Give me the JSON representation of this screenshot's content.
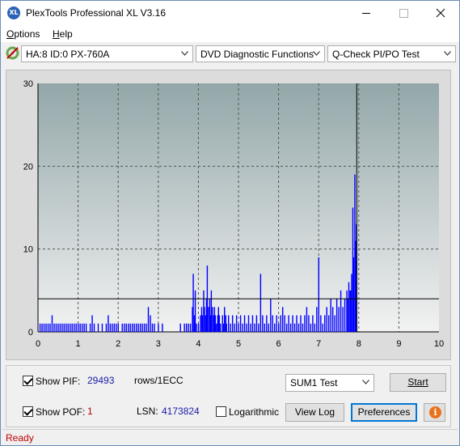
{
  "window": {
    "title": "PlexTools Professional XL V3.16",
    "icon_text": "XL"
  },
  "menu": [
    {
      "label": "Options",
      "accel": "O",
      "rest": "ptions"
    },
    {
      "label": "Help",
      "accel": "H",
      "rest": "elp"
    }
  ],
  "toolbar": {
    "drive": "HA:8 ID:0  PX-760A",
    "function": "DVD Diagnostic Functions",
    "test": "Q-Check PI/PO Test"
  },
  "chart_data": {
    "type": "bar",
    "xlim": [
      0,
      10
    ],
    "ylim": [
      0,
      30
    ],
    "x_ticks": [
      "0",
      "1",
      "2",
      "3",
      "4",
      "5",
      "6",
      "7",
      "8",
      "9",
      "10"
    ],
    "y_ticks": [
      "0",
      "10",
      "20",
      "30"
    ],
    "threshold_line": 4,
    "end_marker_x": 7.95,
    "grid": true,
    "series": [
      {
        "color": "#0000ff",
        "points": [
          [
            0.05,
            1
          ],
          [
            0.1,
            1
          ],
          [
            0.15,
            1
          ],
          [
            0.2,
            1
          ],
          [
            0.25,
            1
          ],
          [
            0.3,
            1
          ],
          [
            0.35,
            2
          ],
          [
            0.4,
            1
          ],
          [
            0.45,
            1
          ],
          [
            0.5,
            1
          ],
          [
            0.55,
            1
          ],
          [
            0.6,
            1
          ],
          [
            0.65,
            1
          ],
          [
            0.7,
            1
          ],
          [
            0.75,
            1
          ],
          [
            0.8,
            1
          ],
          [
            0.85,
            1
          ],
          [
            0.9,
            1
          ],
          [
            0.95,
            1
          ],
          [
            1.0,
            1
          ],
          [
            1.05,
            1
          ],
          [
            1.1,
            1
          ],
          [
            1.15,
            1
          ],
          [
            1.2,
            1
          ],
          [
            1.3,
            1
          ],
          [
            1.35,
            2
          ],
          [
            1.4,
            1
          ],
          [
            1.5,
            1
          ],
          [
            1.6,
            1
          ],
          [
            1.7,
            1
          ],
          [
            1.75,
            2
          ],
          [
            1.8,
            1
          ],
          [
            1.85,
            1
          ],
          [
            1.9,
            1
          ],
          [
            1.95,
            1
          ],
          [
            2.0,
            1
          ],
          [
            2.1,
            1
          ],
          [
            2.15,
            1
          ],
          [
            2.2,
            1
          ],
          [
            2.25,
            1
          ],
          [
            2.3,
            1
          ],
          [
            2.35,
            1
          ],
          [
            2.4,
            1
          ],
          [
            2.45,
            1
          ],
          [
            2.5,
            1
          ],
          [
            2.55,
            1
          ],
          [
            2.6,
            1
          ],
          [
            2.65,
            1
          ],
          [
            2.7,
            1
          ],
          [
            2.75,
            3
          ],
          [
            2.8,
            2
          ],
          [
            2.85,
            1
          ],
          [
            2.9,
            1
          ],
          [
            3.0,
            1
          ],
          [
            3.1,
            1
          ],
          [
            3.55,
            1
          ],
          [
            3.65,
            1
          ],
          [
            3.7,
            1
          ],
          [
            3.75,
            1
          ],
          [
            3.8,
            1
          ],
          [
            3.85,
            3
          ],
          [
            3.87,
            7
          ],
          [
            3.9,
            2
          ],
          [
            3.92,
            5
          ],
          [
            3.95,
            1
          ],
          [
            4.0,
            1
          ],
          [
            4.05,
            2
          ],
          [
            4.08,
            3
          ],
          [
            4.1,
            2
          ],
          [
            4.13,
            5
          ],
          [
            4.15,
            3
          ],
          [
            4.18,
            2
          ],
          [
            4.2,
            4
          ],
          [
            4.22,
            8
          ],
          [
            4.25,
            3
          ],
          [
            4.28,
            4
          ],
          [
            4.3,
            2
          ],
          [
            4.32,
            5
          ],
          [
            4.35,
            3
          ],
          [
            4.38,
            2
          ],
          [
            4.4,
            3
          ],
          [
            4.42,
            2
          ],
          [
            4.45,
            1
          ],
          [
            4.48,
            2
          ],
          [
            4.5,
            3
          ],
          [
            4.52,
            2
          ],
          [
            4.55,
            1
          ],
          [
            4.6,
            2
          ],
          [
            4.62,
            1
          ],
          [
            4.65,
            3
          ],
          [
            4.68,
            2
          ],
          [
            4.7,
            1
          ],
          [
            4.75,
            2
          ],
          [
            4.8,
            1
          ],
          [
            4.85,
            2
          ],
          [
            4.9,
            1
          ],
          [
            4.95,
            2
          ],
          [
            5.0,
            1
          ],
          [
            5.05,
            2
          ],
          [
            5.1,
            1
          ],
          [
            5.15,
            2
          ],
          [
            5.2,
            1
          ],
          [
            5.25,
            2
          ],
          [
            5.3,
            1
          ],
          [
            5.35,
            2
          ],
          [
            5.4,
            1
          ],
          [
            5.45,
            2
          ],
          [
            5.5,
            1
          ],
          [
            5.55,
            7
          ],
          [
            5.6,
            2
          ],
          [
            5.65,
            1
          ],
          [
            5.7,
            2
          ],
          [
            5.75,
            1
          ],
          [
            5.8,
            4
          ],
          [
            5.85,
            2
          ],
          [
            5.9,
            1
          ],
          [
            5.95,
            2
          ],
          [
            6.0,
            1
          ],
          [
            6.05,
            2
          ],
          [
            6.1,
            3
          ],
          [
            6.15,
            2
          ],
          [
            6.2,
            1
          ],
          [
            6.25,
            2
          ],
          [
            6.3,
            1
          ],
          [
            6.35,
            2
          ],
          [
            6.4,
            1
          ],
          [
            6.45,
            2
          ],
          [
            6.5,
            1
          ],
          [
            6.55,
            2
          ],
          [
            6.6,
            1
          ],
          [
            6.65,
            2
          ],
          [
            6.7,
            3
          ],
          [
            6.75,
            2
          ],
          [
            6.8,
            1
          ],
          [
            6.85,
            2
          ],
          [
            6.9,
            1
          ],
          [
            6.95,
            3
          ],
          [
            7.0,
            9
          ],
          [
            7.05,
            2
          ],
          [
            7.1,
            1
          ],
          [
            7.15,
            2
          ],
          [
            7.2,
            3
          ],
          [
            7.25,
            2
          ],
          [
            7.3,
            4
          ],
          [
            7.35,
            3
          ],
          [
            7.4,
            2
          ],
          [
            7.45,
            4
          ],
          [
            7.5,
            3
          ],
          [
            7.55,
            5
          ],
          [
            7.6,
            3
          ],
          [
            7.65,
            4
          ],
          [
            7.7,
            5
          ],
          [
            7.72,
            4
          ],
          [
            7.75,
            6
          ],
          [
            7.78,
            5
          ],
          [
            7.8,
            5
          ],
          [
            7.82,
            7
          ],
          [
            7.85,
            15
          ],
          [
            7.87,
            9
          ],
          [
            7.9,
            19
          ],
          [
            7.92,
            11
          ],
          [
            7.94,
            13
          ]
        ]
      }
    ]
  },
  "panel": {
    "show_pif_label": "Show PIF:",
    "pif_value": "29493",
    "pif_unit": "rows/1ECC",
    "show_pof_label": "Show POF:",
    "pof_value": "1",
    "lsn_label": "LSN:",
    "lsn_value": "4173824",
    "logarithmic_label": "Logarithmic",
    "sum_select": "SUM1 Test",
    "start_label": "Start",
    "view_log_label": "View Log",
    "preferences_label": "Preferences",
    "info_glyph": "i"
  },
  "status": {
    "text": "Ready"
  },
  "colors": {
    "plot_bg_top": "#93a7a9",
    "plot_bg_bottom": "#f2f2f2",
    "bar": "#0000ff",
    "status_text": "#c00000"
  }
}
